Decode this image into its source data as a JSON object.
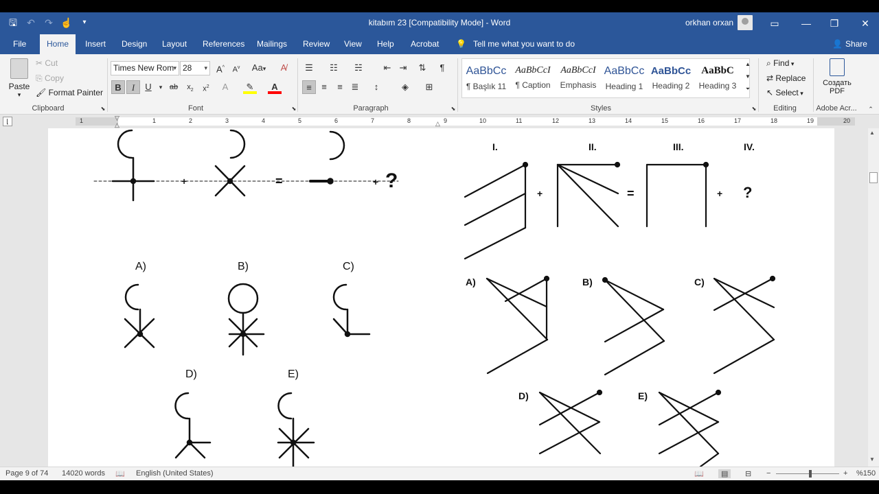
{
  "title_bar": {
    "document_title": "kitabım 23 [Compatibility Mode]  -  Word",
    "user_name": "orkhan orxan"
  },
  "tabs": [
    "File",
    "Home",
    "Insert",
    "Design",
    "Layout",
    "References",
    "Mailings",
    "Review",
    "View",
    "Help",
    "Acrobat"
  ],
  "active_tab": "Home",
  "tell_me": "Tell me what you want to do",
  "share_label": "Share",
  "clipboard": {
    "paste": "Paste",
    "cut": "Cut",
    "copy": "Copy",
    "format_painter": "Format Painter",
    "group_label": "Clipboard"
  },
  "font": {
    "name": "Times New Rom",
    "size": "28",
    "group_label": "Font",
    "case_label": "Aa",
    "bold_pressed": true,
    "italic_pressed": true
  },
  "paragraph": {
    "group_label": "Paragraph"
  },
  "styles": {
    "group_label": "Styles",
    "items": [
      {
        "sample": "AaBbCc",
        "name": "¶ Başlık 11"
      },
      {
        "sample": "AaBbCcI",
        "name": "¶ Caption"
      },
      {
        "sample": "AaBbCcI",
        "name": "Emphasis"
      },
      {
        "sample": "AaBbCc",
        "name": "Heading 1"
      },
      {
        "sample": "AaBbCc",
        "name": "Heading 2"
      },
      {
        "sample": "AaBbC",
        "name": "Heading 3"
      }
    ]
  },
  "editing": {
    "find": "Find",
    "replace": "Replace",
    "select": "Select",
    "group_label": "Editing"
  },
  "adobe": {
    "create_pdf_line1": "Создать",
    "create_pdf_line2": "PDF",
    "group_label": "Adobe Acr..."
  },
  "ruler_numbers": [
    "1",
    "1",
    "2",
    "3",
    "4",
    "5",
    "6",
    "7",
    "8",
    "9",
    "10",
    "11",
    "12",
    "13",
    "14",
    "15",
    "16",
    "17",
    "18",
    "19",
    "20"
  ],
  "document": {
    "left_puzzle": {
      "operators": [
        "+",
        "=",
        "+"
      ],
      "question": "?",
      "options": [
        "A)",
        "B)",
        "C)",
        "D)",
        "E)"
      ]
    },
    "right_puzzle": {
      "headers": [
        "I.",
        "II.",
        "III.",
        "IV."
      ],
      "operators": [
        "+",
        "=",
        "+"
      ],
      "question": "?",
      "options": [
        "A)",
        "B)",
        "C)",
        "D)",
        "E)"
      ]
    }
  },
  "status_bar": {
    "page": "Page 9 of 74",
    "words": "14020 words",
    "language": "English (United States)",
    "zoom": "%150"
  }
}
